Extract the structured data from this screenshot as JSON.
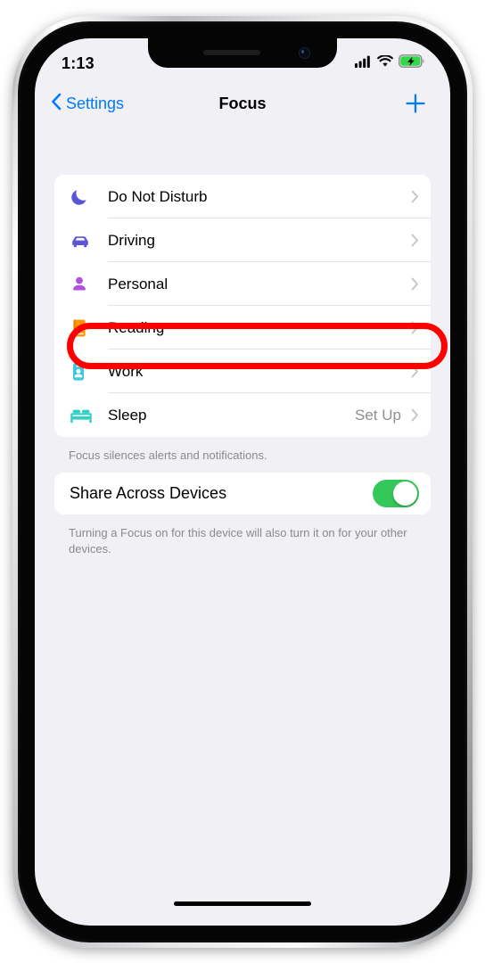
{
  "status_bar": {
    "time": "1:13",
    "cellular_icon": "cellular-bars-icon",
    "wifi_icon": "wifi-icon",
    "battery_icon": "battery-charging-icon",
    "battery_charging": true
  },
  "nav_bar": {
    "back_label": "Settings",
    "back_icon": "chevron-left-icon",
    "title": "Focus",
    "add_icon": "plus-icon",
    "tint_color": "#007AFF"
  },
  "focus_list": {
    "rows": [
      {
        "label": "Do Not Disturb",
        "icon": "moon-icon",
        "color": "#5856D6",
        "value": ""
      },
      {
        "label": "Driving",
        "icon": "car-icon",
        "color": "#5856D6",
        "value": ""
      },
      {
        "label": "Personal",
        "icon": "person-icon",
        "color": "#AF52DE",
        "value": ""
      },
      {
        "label": "Reading",
        "icon": "book-icon",
        "color": "#FF9500",
        "value": ""
      },
      {
        "label": "Work",
        "icon": "id-badge-icon",
        "color": "#3FC8DC",
        "value": ""
      },
      {
        "label": "Sleep",
        "icon": "bed-icon",
        "color": "#31D0C6",
        "value": "Set Up"
      }
    ],
    "footnote": "Focus silences alerts and notifications."
  },
  "share_section": {
    "label": "Share Across Devices",
    "toggle_on": true,
    "toggle_color": "#34C759",
    "footnote": "Turning a Focus on for this device will also turn it on for your other devices."
  },
  "annotation": {
    "shape": "oval-highlight",
    "color": "#FE0000",
    "target": "Reading"
  },
  "home_indicator": "home-indicator"
}
